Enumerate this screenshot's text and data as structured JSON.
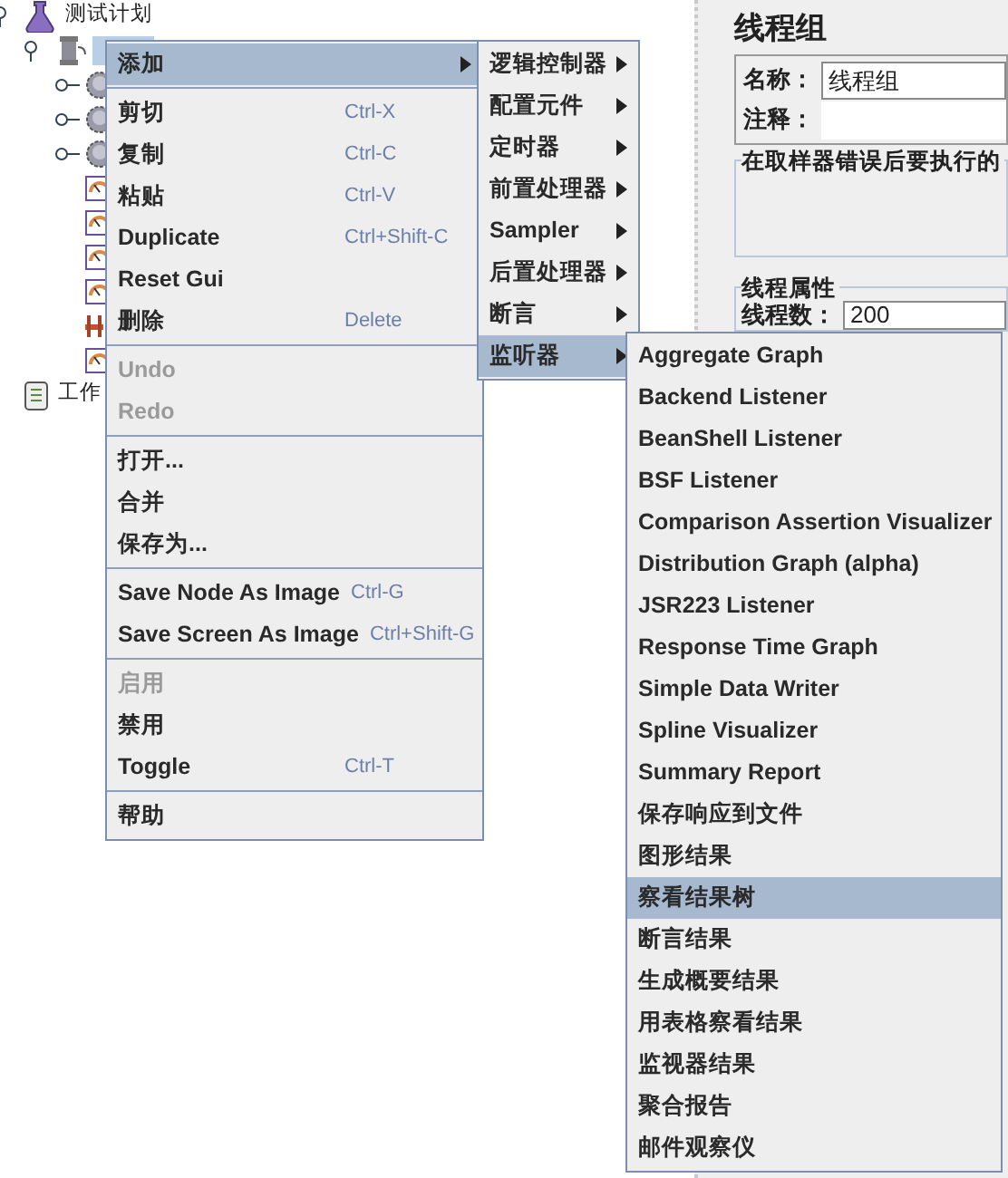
{
  "tree": [
    {
      "label": "测试计划",
      "kind": "plan",
      "expanded": true,
      "children": [
        {
          "kind": "thread-group",
          "selected": true,
          "expanded": true,
          "children": [
            {
              "kind": "timer",
              "expanded": false
            },
            {
              "kind": "timer",
              "expanded": false
            },
            {
              "kind": "timer",
              "expanded": false
            },
            {
              "kind": "listener"
            },
            {
              "kind": "listener"
            },
            {
              "kind": "listener"
            },
            {
              "kind": "listener"
            },
            {
              "kind": "sampler"
            },
            {
              "kind": "listener"
            }
          ]
        }
      ]
    },
    {
      "label": "工作",
      "kind": "workbench"
    }
  ],
  "panel": {
    "title": "线程组",
    "fields": [
      {
        "label": "名称：",
        "value": "线程组"
      },
      {
        "label": "注释："
      }
    ],
    "groups": [
      {
        "title": "在取样器错误后要执行的"
      },
      {
        "title": "线程属性",
        "fields": [
          {
            "label": "线程数：",
            "value": "200"
          }
        ]
      }
    ]
  },
  "context_menu": [
    {
      "kind": "item",
      "label": "添加",
      "submenu": true,
      "selected": true,
      "disabled": false
    },
    {
      "kind": "separator"
    },
    {
      "kind": "item",
      "label": "剪切",
      "shortcut": "Ctrl-X",
      "selected": false,
      "disabled": false
    },
    {
      "kind": "item",
      "label": "复制",
      "shortcut": "Ctrl-C",
      "selected": false,
      "disabled": false
    },
    {
      "kind": "item",
      "label": "粘贴",
      "shortcut": "Ctrl-V",
      "selected": false,
      "disabled": false
    },
    {
      "kind": "item",
      "label": "Duplicate",
      "shortcut": "Ctrl+Shift-C",
      "selected": false,
      "disabled": false
    },
    {
      "kind": "item",
      "label": "Reset Gui",
      "selected": false,
      "disabled": false
    },
    {
      "kind": "item",
      "label": "删除",
      "shortcut": "Delete",
      "selected": false,
      "disabled": false
    },
    {
      "kind": "separator"
    },
    {
      "kind": "item",
      "label": "Undo",
      "selected": false,
      "disabled": true
    },
    {
      "kind": "item",
      "label": "Redo",
      "selected": false,
      "disabled": true
    },
    {
      "kind": "separator"
    },
    {
      "kind": "item",
      "label": "打开...",
      "selected": false,
      "disabled": false
    },
    {
      "kind": "item",
      "label": "合并",
      "selected": false,
      "disabled": false
    },
    {
      "kind": "item",
      "label": "保存为...",
      "selected": false,
      "disabled": false
    },
    {
      "kind": "separator"
    },
    {
      "kind": "item",
      "label": "Save Node As Image",
      "shortcut": "Ctrl-G",
      "selected": false,
      "disabled": false
    },
    {
      "kind": "item",
      "label": "Save Screen As Image",
      "shortcut": "Ctrl+Shift-G",
      "selected": false,
      "disabled": false
    },
    {
      "kind": "separator"
    },
    {
      "kind": "item",
      "label": "启用",
      "selected": false,
      "disabled": true
    },
    {
      "kind": "item",
      "label": "禁用",
      "selected": false,
      "disabled": false
    },
    {
      "kind": "item",
      "label": "Toggle",
      "shortcut": "Ctrl-T",
      "selected": false,
      "disabled": false
    },
    {
      "kind": "separator"
    },
    {
      "kind": "item",
      "label": "帮助",
      "selected": false,
      "disabled": false
    }
  ],
  "add_submenu": [
    {
      "kind": "item",
      "label": "逻辑控制器",
      "submenu": true,
      "selected": false
    },
    {
      "kind": "item",
      "label": "配置元件",
      "submenu": true,
      "selected": false
    },
    {
      "kind": "item",
      "label": "定时器",
      "submenu": true,
      "selected": false
    },
    {
      "kind": "item",
      "label": "前置处理器",
      "submenu": true,
      "selected": false
    },
    {
      "kind": "item",
      "label": "Sampler",
      "submenu": true,
      "selected": false
    },
    {
      "kind": "item",
      "label": "后置处理器",
      "submenu": true,
      "selected": false
    },
    {
      "kind": "item",
      "label": "断言",
      "submenu": true,
      "selected": false
    },
    {
      "kind": "item",
      "label": "监听器",
      "submenu": true,
      "selected": true
    }
  ],
  "listener_submenu": [
    {
      "kind": "item",
      "label": "Aggregate Graph",
      "selected": false
    },
    {
      "kind": "item",
      "label": "Backend Listener",
      "selected": false
    },
    {
      "kind": "item",
      "label": "BeanShell Listener",
      "selected": false
    },
    {
      "kind": "item",
      "label": "BSF Listener",
      "selected": false
    },
    {
      "kind": "item",
      "label": "Comparison Assertion Visualizer",
      "selected": false
    },
    {
      "kind": "item",
      "label": "Distribution Graph (alpha)",
      "selected": false
    },
    {
      "kind": "item",
      "label": "JSR223 Listener",
      "selected": false
    },
    {
      "kind": "item",
      "label": "Response Time Graph",
      "selected": false
    },
    {
      "kind": "item",
      "label": "Simple Data Writer",
      "selected": false
    },
    {
      "kind": "item",
      "label": "Spline Visualizer",
      "selected": false
    },
    {
      "kind": "item",
      "label": "Summary Report",
      "selected": false
    },
    {
      "kind": "item",
      "label": "保存响应到文件",
      "selected": false
    },
    {
      "kind": "item",
      "label": "图形结果",
      "selected": false
    },
    {
      "kind": "item",
      "label": "察看结果树",
      "selected": true
    },
    {
      "kind": "item",
      "label": "断言结果",
      "selected": false
    },
    {
      "kind": "item",
      "label": "生成概要结果",
      "selected": false
    },
    {
      "kind": "item",
      "label": "用表格察看结果",
      "selected": false
    },
    {
      "kind": "item",
      "label": "监视器结果",
      "selected": false
    },
    {
      "kind": "item",
      "label": "聚合报告",
      "selected": false
    },
    {
      "kind": "item",
      "label": "邮件观察仪",
      "selected": false
    }
  ]
}
